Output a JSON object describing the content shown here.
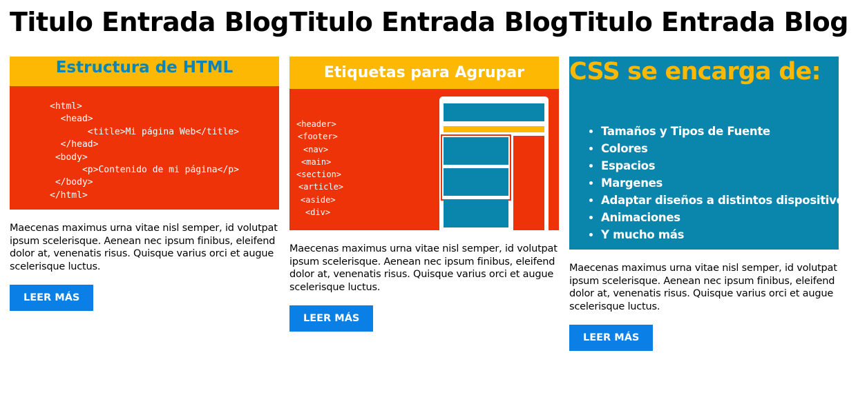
{
  "posts": [
    {
      "title": "Titulo Entrada Blog",
      "image": {
        "heading": "Estructura de HTML",
        "code_lines": [
          "<html>",
          "  <head>",
          "       <title>Mi página Web</title>",
          "  </head>",
          " <body>",
          "      <p>Contenido de mi página</p>",
          " </body>",
          "</html>"
        ]
      },
      "excerpt": "Maecenas maximus urna vitae nisl semper, id volutpat ipsum scelerisque. Aenean nec ipsum finibus, eleifend dolor at, venenatis risus. Quisque varius orci et augue scelerisque luctus.",
      "button_label": "LEER MÁS"
    },
    {
      "title": "Titulo Entrada Blog",
      "image": {
        "heading": "Etiquetas para Agrupar",
        "tags": [
          "<header>",
          "<footer>",
          "<nav>",
          "<main>",
          "<section>",
          "<article>",
          "<aside>",
          "<div>"
        ]
      },
      "excerpt": "Maecenas maximus urna vitae nisl semper, id volutpat ipsum scelerisque. Aenean nec ipsum finibus, eleifend dolor at, venenatis risus. Quisque varius orci et augue scelerisque luctus.",
      "button_label": "LEER MÁS"
    },
    {
      "title": "Titulo Entrada Blog",
      "image": {
        "heading": "CSS se encarga de:",
        "bullets": [
          "Tamaños y Tipos de Fuente",
          "Colores",
          "Espacios",
          "Margenes",
          "Adaptar diseños a distintos dispositivos.",
          "Animaciones",
          "Y mucho más"
        ]
      },
      "excerpt": "Maecenas maximus urna vitae nisl semper, id volutpat ipsum scelerisque. Aenean nec ipsum finibus, eleifend dolor at, venenatis risus. Quisque varius orci et augue scelerisque luctus.",
      "button_label": "LEER MÁS"
    }
  ],
  "colors": {
    "button": "#0a7fe6",
    "orange_red": "#ef3308",
    "yellow": "#fcb802",
    "teal": "#0a86ad"
  }
}
